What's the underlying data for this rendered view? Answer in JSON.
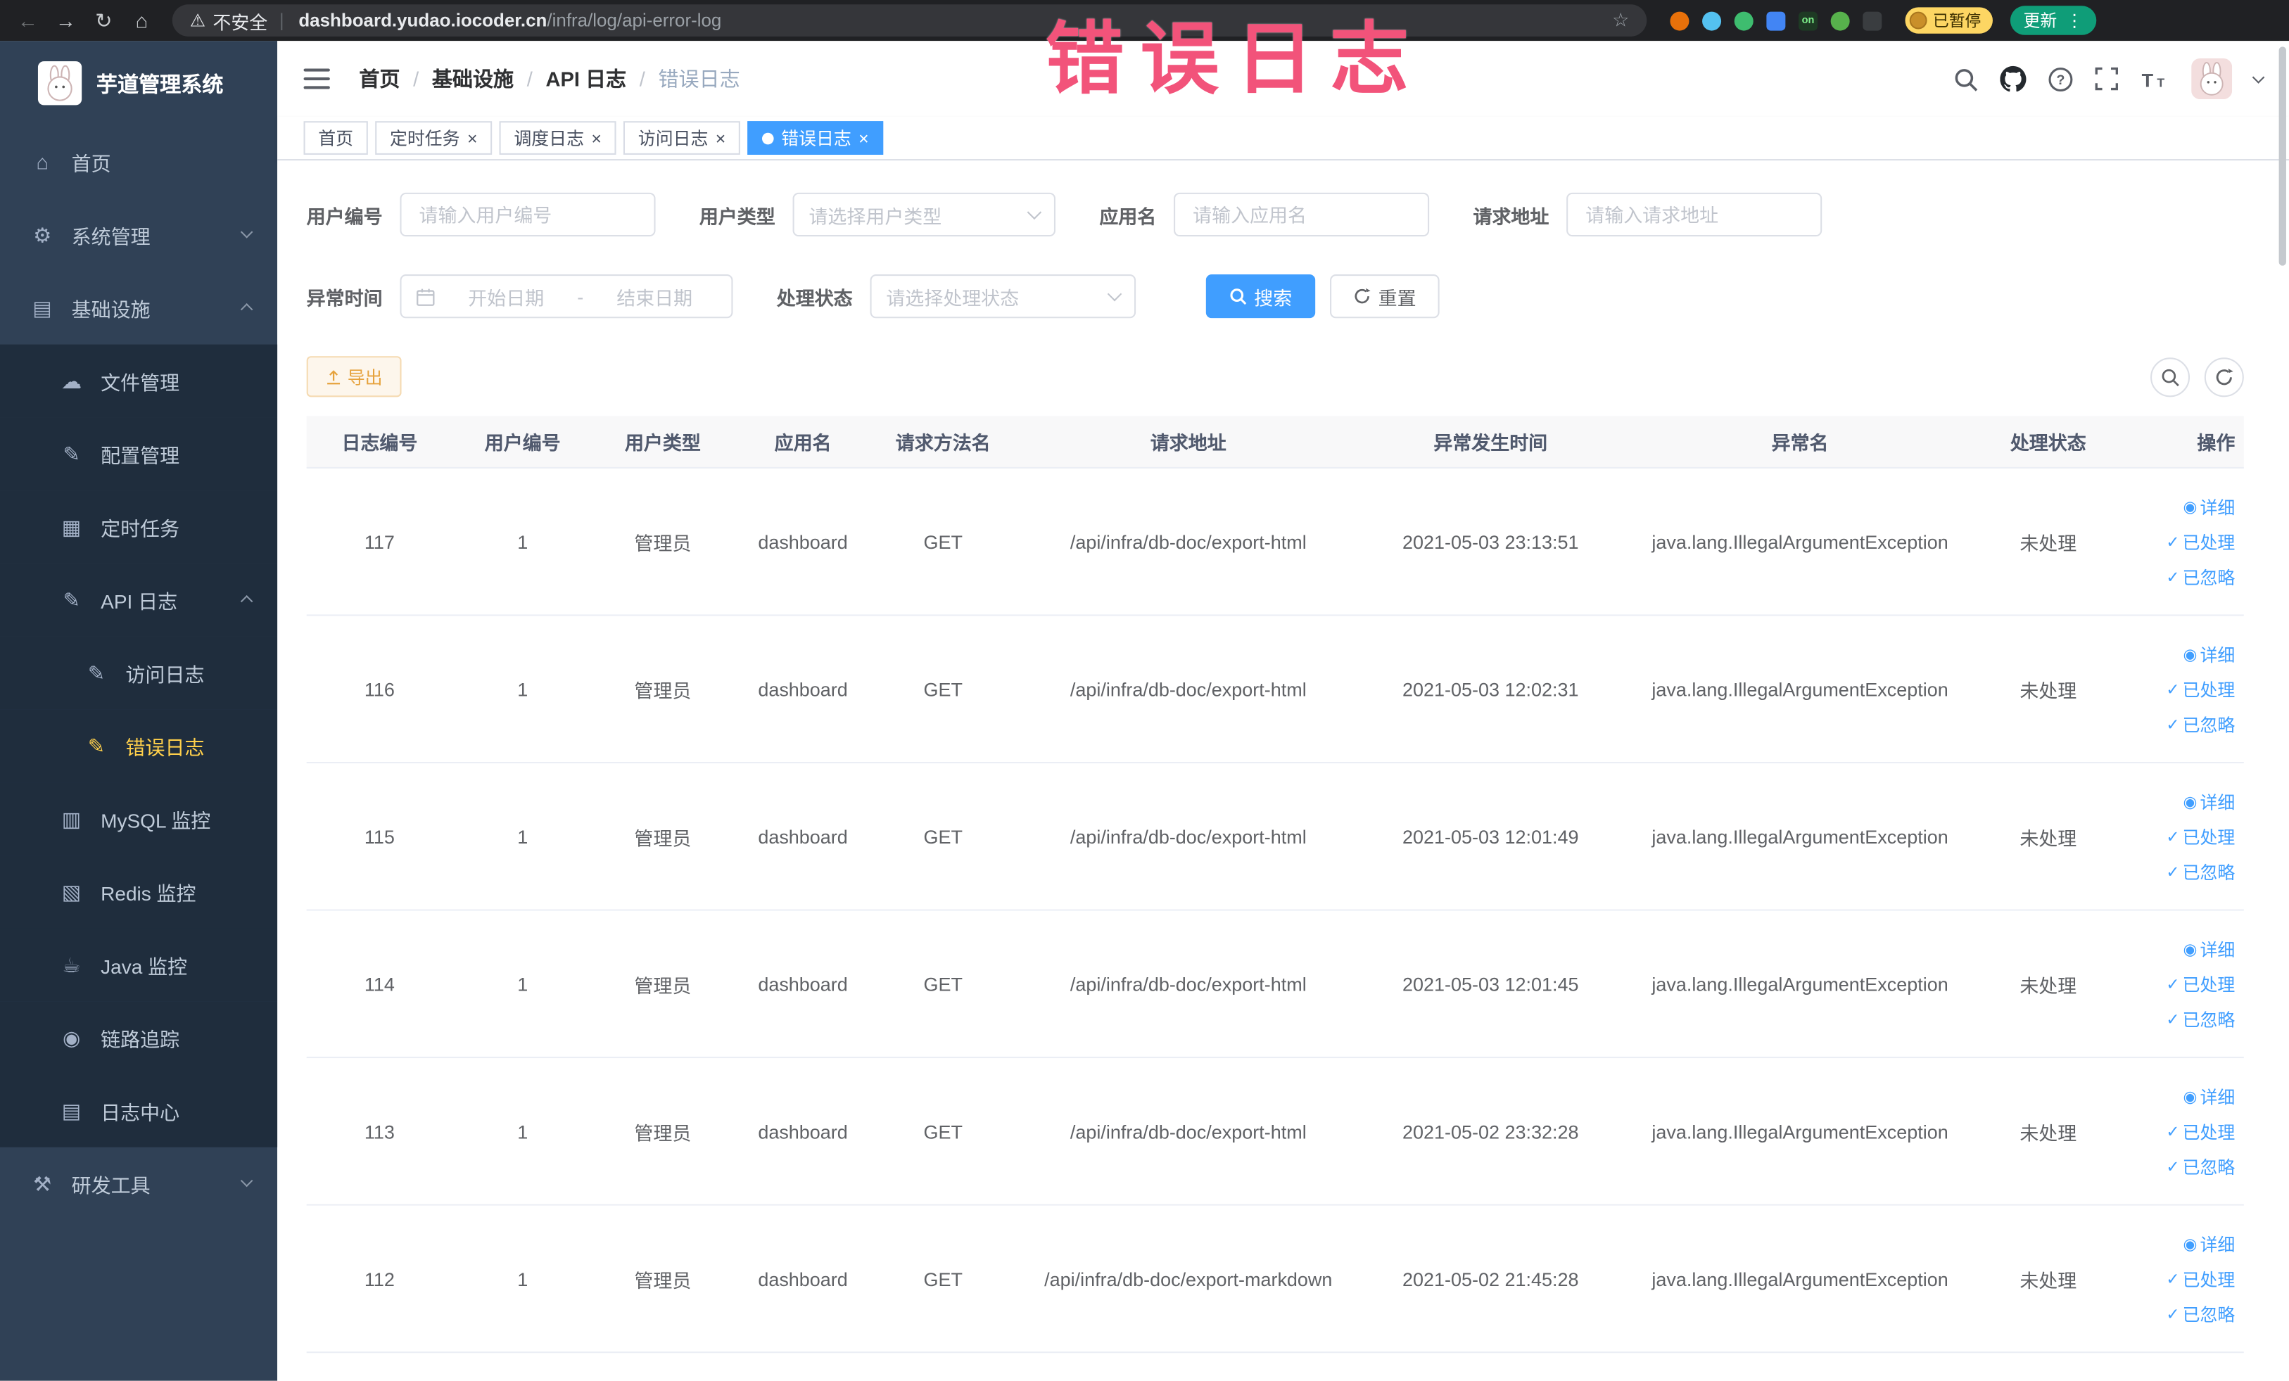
{
  "annotation": {
    "text": "错误日志"
  },
  "browser": {
    "security_label": "不安全",
    "url_domain": "dashboard.yudao.iocoder.cn",
    "url_path": "/infra/log/api-error-log",
    "paused_badge": "已暂停",
    "update_label": "更新",
    "extensions": [
      {
        "id": "ext-orange",
        "name": "record-extension-icon",
        "shape": "circle",
        "color": "#e8710a",
        "label": ""
      },
      {
        "id": "ext-drop",
        "name": "drop-extension-icon",
        "shape": "circle",
        "color": "#54c1f0",
        "label": ""
      },
      {
        "id": "ext-green",
        "name": "green-extension-icon",
        "shape": "circle",
        "color": "#3ebd6f",
        "label": ""
      },
      {
        "id": "ext-grid",
        "name": "grid-extension-icon",
        "shape": "square",
        "color": "#4285f4",
        "label": ""
      },
      {
        "id": "ext-on",
        "name": "on-badge-extension-icon",
        "shape": "square",
        "color": "#1e3a24",
        "label": "on"
      },
      {
        "id": "ext-leaf",
        "name": "leaf-extension-icon",
        "shape": "circle",
        "color": "#57b14c",
        "label": ""
      },
      {
        "id": "ext-puzzle",
        "name": "puzzle-extension-icon",
        "shape": "square",
        "color": "#3a3d40",
        "label": ""
      }
    ]
  },
  "sidebar": {
    "logo_title": "芋道管理系统",
    "items": [
      {
        "id": "home",
        "label": "首页",
        "icon": "home-icon",
        "glyph": "⌂",
        "level": 0
      },
      {
        "id": "system",
        "label": "系统管理",
        "icon": "gear-icon",
        "glyph": "⚙",
        "level": 0,
        "chevron": "down"
      },
      {
        "id": "infra",
        "label": "基础设施",
        "icon": "monitor-icon",
        "glyph": "▤",
        "level": 0,
        "chevron": "up"
      },
      {
        "id": "file",
        "label": "文件管理",
        "icon": "cloud-icon",
        "glyph": "☁",
        "level": 1
      },
      {
        "id": "config",
        "label": "配置管理",
        "icon": "edit-icon",
        "glyph": "✎",
        "level": 1
      },
      {
        "id": "job",
        "label": "定时任务",
        "icon": "task-icon",
        "glyph": "▦",
        "level": 1
      },
      {
        "id": "api-log",
        "label": "API 日志",
        "icon": "log-icon",
        "glyph": "✎",
        "level": 1,
        "chevron": "up"
      },
      {
        "id": "access-log",
        "label": "访问日志",
        "icon": "access-log-icon",
        "glyph": "✎",
        "level": 2
      },
      {
        "id": "error-log",
        "label": "错误日志",
        "icon": "error-log-icon",
        "glyph": "✎",
        "level": 2,
        "active": true
      },
      {
        "id": "mysql",
        "label": "MySQL 监控",
        "icon": "mysql-monitor-icon",
        "glyph": "▥",
        "level": 1
      },
      {
        "id": "redis",
        "label": "Redis 监控",
        "icon": "redis-monitor-icon",
        "glyph": "▧",
        "level": 1
      },
      {
        "id": "java",
        "label": "Java 监控",
        "icon": "coffee-icon",
        "glyph": "☕",
        "level": 1
      },
      {
        "id": "trace",
        "label": "链路追踪",
        "icon": "eye-icon",
        "glyph": "◉",
        "level": 1
      },
      {
        "id": "log-center",
        "label": "日志中心",
        "icon": "log-center-icon",
        "glyph": "▤",
        "level": 1
      },
      {
        "id": "dev-tools",
        "label": "研发工具",
        "icon": "hammer-icon",
        "glyph": "⚒",
        "level": 0,
        "chevron": "down"
      }
    ]
  },
  "header": {
    "breadcrumb": [
      "首页",
      "基础设施",
      "API 日志",
      "错误日志"
    ]
  },
  "tabs": [
    {
      "id": "home",
      "label": "首页",
      "closable": false,
      "active": false
    },
    {
      "id": "job",
      "label": "定时任务",
      "closable": true,
      "active": false
    },
    {
      "id": "job-log",
      "label": "调度日志",
      "closable": true,
      "active": false
    },
    {
      "id": "access-log",
      "label": "访问日志",
      "closable": true,
      "active": false
    },
    {
      "id": "error-log",
      "label": "错误日志",
      "closable": true,
      "active": true
    }
  ],
  "filters": {
    "user_id": {
      "label": "用户编号",
      "placeholder": "请输入用户编号"
    },
    "user_type": {
      "label": "用户类型",
      "placeholder": "请选择用户类型"
    },
    "app_name": {
      "label": "应用名",
      "placeholder": "请输入应用名"
    },
    "request_url": {
      "label": "请求地址",
      "placeholder": "请输入请求地址"
    },
    "exception_time": {
      "label": "异常时间",
      "start_placeholder": "开始日期",
      "separator": "-",
      "end_placeholder": "结束日期"
    },
    "process_status": {
      "label": "处理状态",
      "placeholder": "请选择处理状态"
    },
    "search_label": "搜索",
    "reset_label": "重置"
  },
  "toolbar": {
    "export_label": "导出"
  },
  "table": {
    "columns": [
      {
        "key": "id",
        "label": "日志编号"
      },
      {
        "key": "userId",
        "label": "用户编号"
      },
      {
        "key": "userType",
        "label": "用户类型"
      },
      {
        "key": "appName",
        "label": "应用名"
      },
      {
        "key": "method",
        "label": "请求方法名"
      },
      {
        "key": "url",
        "label": "请求地址"
      },
      {
        "key": "time",
        "label": "异常发生时间"
      },
      {
        "key": "exName",
        "label": "异常名"
      },
      {
        "key": "status",
        "label": "处理状态"
      },
      {
        "key": "actions",
        "label": "操作"
      }
    ],
    "row_actions": [
      {
        "id": "detail",
        "label": "详细",
        "icon": "eye-icon",
        "glyph": "◉"
      },
      {
        "id": "processed",
        "label": "已处理",
        "icon": "check-icon",
        "glyph": "✓"
      },
      {
        "id": "ignored",
        "label": "已忽略",
        "icon": "check-icon",
        "glyph": "✓"
      }
    ],
    "rows": [
      {
        "id": "117",
        "userId": "1",
        "userType": "管理员",
        "appName": "dashboard",
        "method": "GET",
        "url": "/api/infra/db-doc/export-html",
        "time": "2021-05-03 23:13:51",
        "exName": "java.lang.IllegalArgumentException",
        "status": "未处理"
      },
      {
        "id": "116",
        "userId": "1",
        "userType": "管理员",
        "appName": "dashboard",
        "method": "GET",
        "url": "/api/infra/db-doc/export-html",
        "time": "2021-05-03 12:02:31",
        "exName": "java.lang.IllegalArgumentException",
        "status": "未处理"
      },
      {
        "id": "115",
        "userId": "1",
        "userType": "管理员",
        "appName": "dashboard",
        "method": "GET",
        "url": "/api/infra/db-doc/export-html",
        "time": "2021-05-03 12:01:49",
        "exName": "java.lang.IllegalArgumentException",
        "status": "未处理"
      },
      {
        "id": "114",
        "userId": "1",
        "userType": "管理员",
        "appName": "dashboard",
        "method": "GET",
        "url": "/api/infra/db-doc/export-html",
        "time": "2021-05-03 12:01:45",
        "exName": "java.lang.IllegalArgumentException",
        "status": "未处理"
      },
      {
        "id": "113",
        "userId": "1",
        "userType": "管理员",
        "appName": "dashboard",
        "method": "GET",
        "url": "/api/infra/db-doc/export-html",
        "time": "2021-05-02 23:32:28",
        "exName": "java.lang.IllegalArgumentException",
        "status": "未处理"
      },
      {
        "id": "112",
        "userId": "1",
        "userType": "管理员",
        "appName": "dashboard",
        "method": "GET",
        "url": "/api/infra/db-doc/export-markdown",
        "time": "2021-05-02 21:45:28",
        "exName": "java.lang.IllegalArgumentException",
        "status": "未处理"
      }
    ]
  }
}
